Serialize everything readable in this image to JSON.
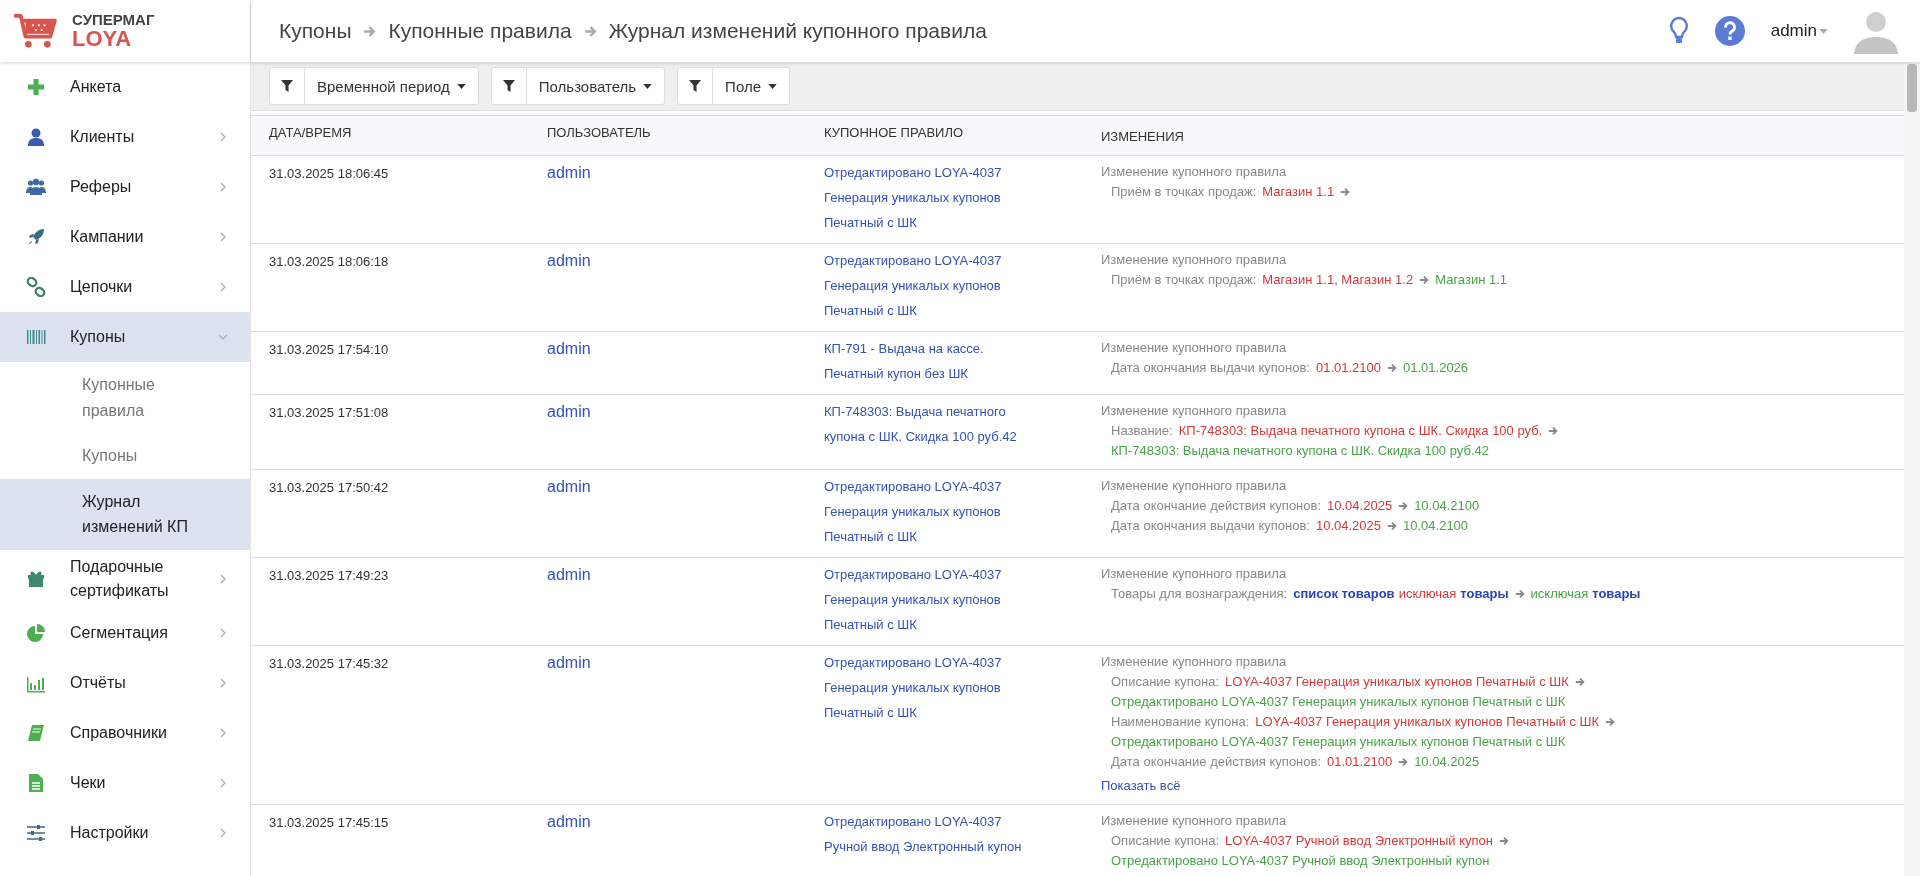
{
  "header": {
    "logo": {
      "top": "СУПЕРМАГ",
      "bottom": "LOYA"
    },
    "breadcrumbs": [
      "Купоны",
      "Купонные правила",
      "Журнал изменений купонного правила"
    ],
    "user": "admin"
  },
  "sidebar": {
    "items": [
      {
        "label": "Анкета",
        "kind": "link",
        "selected": false
      },
      {
        "label": "Клиенты",
        "kind": "group",
        "expanded": false,
        "selected": false
      },
      {
        "label": "Реферы",
        "kind": "group",
        "expanded": false,
        "selected": false
      },
      {
        "label": "Кампании",
        "kind": "group",
        "expanded": false,
        "selected": false
      },
      {
        "label": "Цепочки",
        "kind": "group",
        "expanded": false,
        "selected": false
      },
      {
        "label": "Купоны",
        "kind": "group",
        "expanded": true,
        "selected": true,
        "children": [
          {
            "label": "Купонные правила",
            "selected": false
          },
          {
            "label": "Купоны",
            "selected": false
          },
          {
            "label": "Журнал изменений КП",
            "selected": true
          }
        ]
      },
      {
        "label": "Подарочные сертификаты",
        "kind": "group",
        "expanded": false,
        "selected": false
      },
      {
        "label": "Сегментация",
        "kind": "group",
        "expanded": false,
        "selected": false
      },
      {
        "label": "Отчёты",
        "kind": "group",
        "expanded": false,
        "selected": false
      },
      {
        "label": "Справочники",
        "kind": "group",
        "expanded": false,
        "selected": false
      },
      {
        "label": "Чеки",
        "kind": "group",
        "expanded": false,
        "selected": false
      },
      {
        "label": "Настройки",
        "kind": "group",
        "expanded": false,
        "selected": false
      }
    ]
  },
  "filters": [
    "Временной период",
    "Пользователь",
    "Поле"
  ],
  "table": {
    "columns": [
      "ДАТА/ВРЕМЯ",
      "ПОЛЬЗОВАТЕЛЬ",
      "КУПОННОЕ ПРАВИЛО",
      "ИЗМЕНЕНИЯ"
    ],
    "rows": [
      {
        "datetime": "31.03.2025 18:06:45",
        "user": "admin",
        "rule": "Отредактировано LOYA-4037 Генерация уникалых купонов Печатный с ШК",
        "changes": {
          "title": "Изменение купонного правила",
          "items": [
            {
              "field": "Приём в точках продаж:",
              "old": [
                {
                  "text": "Магазин 1.1",
                  "kind": "removed"
                }
              ]
            }
          ]
        }
      },
      {
        "datetime": "31.03.2025 18:06:18",
        "user": "admin",
        "rule": "Отредактировано LOYA-4037 Генерация уникалых купонов Печатный с ШК",
        "changes": {
          "title": "Изменение купонного правила",
          "items": [
            {
              "field": "Приём в точках продаж:",
              "old": [
                {
                  "text": "Магазин 1.1, Магазин 1.2",
                  "kind": "removed"
                }
              ],
              "new": [
                {
                  "text": "Магазин 1.1",
                  "kind": "added"
                }
              ]
            }
          ]
        }
      },
      {
        "datetime": "31.03.2025 17:54:10",
        "user": "admin",
        "rule": "КП-791 - Выдача на кассе. Печатный купон без ШК",
        "changes": {
          "title": "Изменение купонного правила",
          "items": [
            {
              "field": "Дата окончания выдачи купонов:",
              "old": [
                {
                  "text": "01.01.2100",
                  "kind": "removed"
                }
              ],
              "new": [
                {
                  "text": "01.01.2026",
                  "kind": "added"
                }
              ]
            }
          ]
        }
      },
      {
        "datetime": "31.03.2025 17:51:08",
        "user": "admin",
        "rule": "КП-748303: Выдача печатного купона с ШК. Скидка 100 руб.42",
        "changes": {
          "title": "Изменение купонного правила",
          "items": [
            {
              "field": "Название:",
              "old": [
                {
                  "text": "КП-748303: Выдача печатного купона с ШК. Скидка 100 руб.",
                  "kind": "removed"
                }
              ],
              "new": [
                {
                  "text": "КП-748303: Выдача печатного купона с ШК. Скидка 100 руб.42",
                  "kind": "added"
                }
              ]
            }
          ]
        }
      },
      {
        "datetime": "31.03.2025 17:50:42",
        "user": "admin",
        "rule": "Отредактировано LOYA-4037 Генерация уникалых купонов Печатный с ШК",
        "changes": {
          "title": "Изменение купонного правила",
          "items": [
            {
              "field": "Дата окончание действия купонов:",
              "old": [
                {
                  "text": "10.04.2025",
                  "kind": "removed"
                }
              ],
              "new": [
                {
                  "text": "10.04.2100",
                  "kind": "added"
                }
              ]
            },
            {
              "field": "Дата окончания выдачи купонов:",
              "old": [
                {
                  "text": "10.04.2025",
                  "kind": "removed"
                }
              ],
              "new": [
                {
                  "text": "10.04.2100",
                  "kind": "added"
                }
              ]
            }
          ]
        }
      },
      {
        "datetime": "31.03.2025 17:49:23",
        "user": "admin",
        "rule": "Отредактировано LOYA-4037 Генерация уникалых купонов Печатный с ШК",
        "changes": {
          "title": "Изменение купонного правила",
          "items": [
            {
              "field": "Товары для вознаграждения:",
              "old": [
                {
                  "text": "список товаров",
                  "kind": "term"
                },
                {
                  "text": "исключая",
                  "kind": "removed"
                },
                {
                  "text": "товары",
                  "kind": "term"
                }
              ],
              "new": [
                {
                  "text": "исключая",
                  "kind": "added"
                },
                {
                  "text": "товары",
                  "kind": "term"
                }
              ]
            }
          ]
        }
      },
      {
        "datetime": "31.03.2025 17:45:32",
        "user": "admin",
        "rule": "Отредактировано LOYA-4037 Генерация уникалых купонов Печатный с ШК",
        "changes": {
          "title": "Изменение купонного правила",
          "items": [
            {
              "field": "Описание купона:",
              "old": [
                {
                  "text": "LOYA-4037 Генерация уникалых купонов Печатный с ШК",
                  "kind": "removed"
                }
              ],
              "new": [
                {
                  "text": "Отредактировано LOYA-4037 Генерация уникалых купонов Печатный с ШК",
                  "kind": "added"
                }
              ]
            },
            {
              "field": "Наименование купона:",
              "old": [
                {
                  "text": "LOYA-4037 Генерация уникалых купонов Печатный с ШК",
                  "kind": "removed"
                }
              ],
              "new": [
                {
                  "text": "Отредактировано LOYA-4037 Генерация уникалых купонов Печатный с ШК",
                  "kind": "added"
                }
              ]
            },
            {
              "field": "Дата окончание действия купонов:",
              "old": [
                {
                  "text": "01.01.2100",
                  "kind": "removed"
                }
              ],
              "new": [
                {
                  "text": "10.04.2025",
                  "kind": "added"
                }
              ]
            }
          ],
          "show_all": "Показать всё"
        }
      },
      {
        "datetime": "31.03.2025 17:45:15",
        "user": "admin",
        "rule": "Отредактировано LOYA-4037 Ручной ввод Электронный купон",
        "changes": {
          "title": "Изменение купонного правила",
          "items": [
            {
              "field": "Описание купона:",
              "old": [
                {
                  "text": "LOYA-4037 Ручной ввод Электронный купон",
                  "kind": "removed"
                }
              ],
              "new": [
                {
                  "text": "Отредактировано LOYA-4037 Ручной ввод Электронный купон",
                  "kind": "added"
                }
              ]
            }
          ]
        }
      }
    ]
  }
}
